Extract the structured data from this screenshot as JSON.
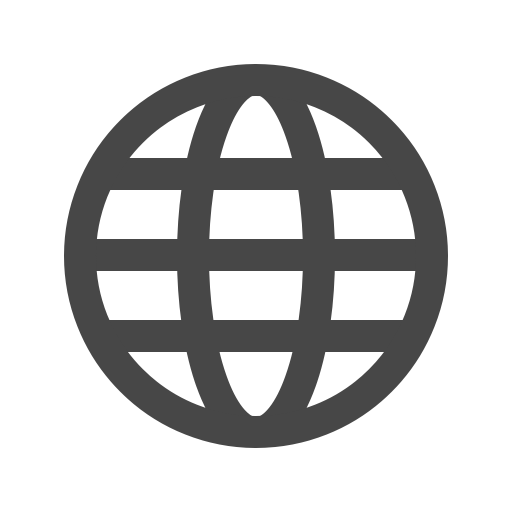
{
  "icon": {
    "name": "globe-icon",
    "color": "#474747",
    "background": "#ffffff"
  }
}
